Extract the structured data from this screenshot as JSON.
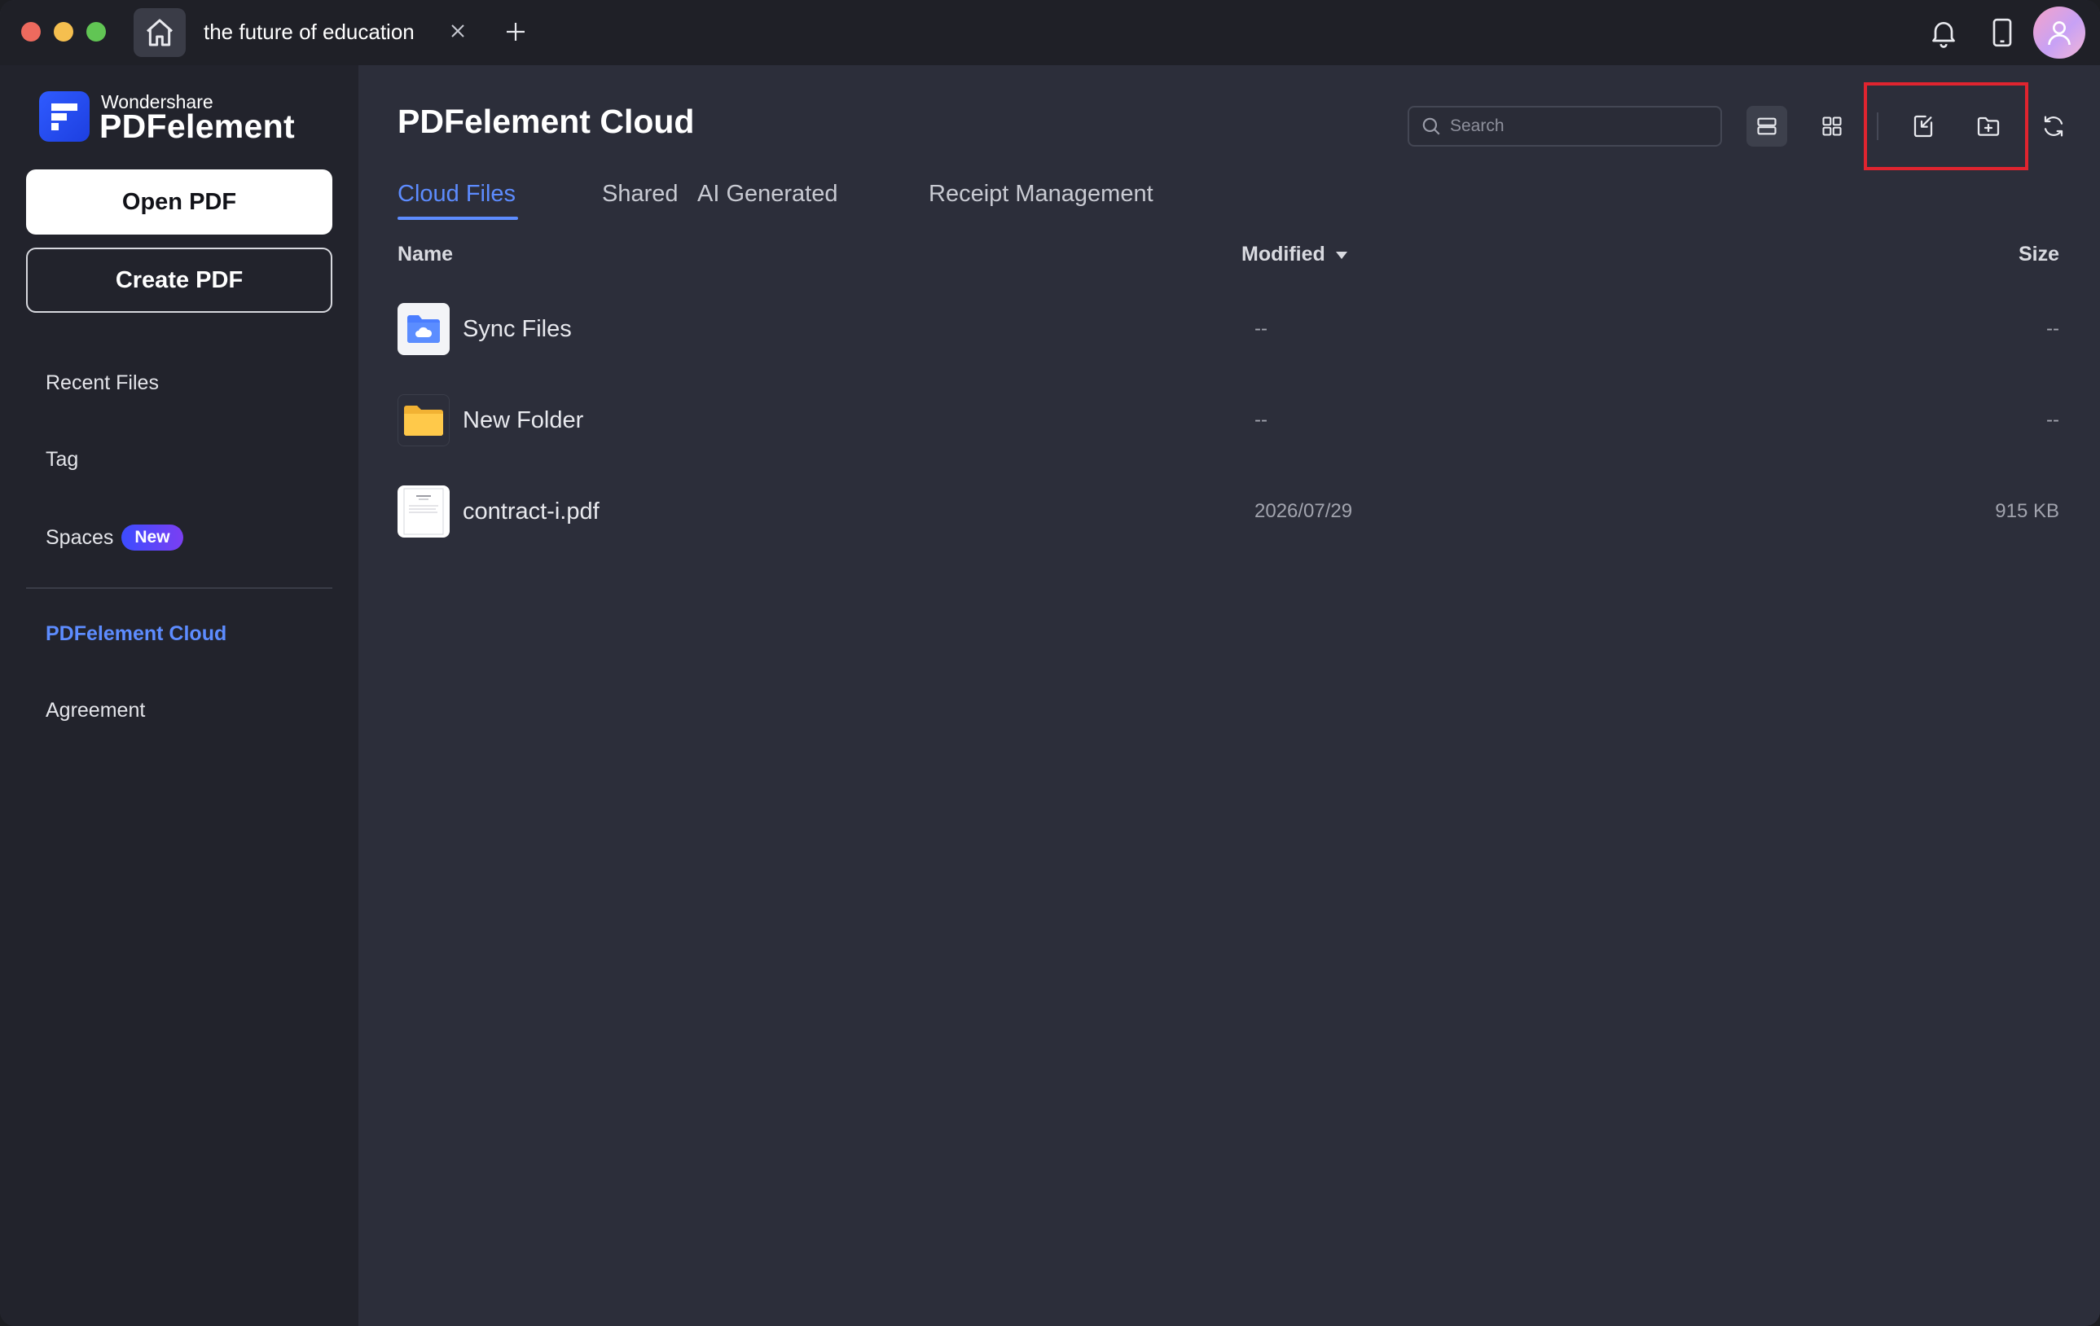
{
  "titlebar": {
    "tab_title": "the future of education"
  },
  "sidebar": {
    "brand_small": "Wondershare",
    "brand_big": "PDFelement",
    "open_pdf_label": "Open PDF",
    "create_pdf_label": "Create PDF",
    "items": {
      "recent": "Recent Files",
      "tag": "Tag",
      "spaces": "Spaces",
      "spaces_badge": "New",
      "cloud": "PDFelement Cloud",
      "agreement": "Agreement"
    },
    "active_item": "PDFelement Cloud"
  },
  "main": {
    "title": "PDFelement Cloud",
    "search_placeholder": "Search",
    "tabs": {
      "cloud_files": "Cloud Files",
      "shared": "Shared",
      "ai_generated": "AI Generated",
      "receipt_management": "Receipt Management"
    },
    "active_tab": "Cloud Files",
    "columns": {
      "name": "Name",
      "modified": "Modified",
      "size": "Size"
    },
    "rows": [
      {
        "name": "Sync Files",
        "modified": "--",
        "size": "--",
        "icon": "cloud-folder-icon"
      },
      {
        "name": "New Folder",
        "modified": "--",
        "size": "--",
        "icon": "folder-icon"
      },
      {
        "name": "contract-i.pdf",
        "modified": "2026/07/29",
        "size": "915 KB",
        "icon": "pdf-thumbnail-icon"
      }
    ]
  },
  "colors": {
    "accent": "#5d8cff",
    "highlight": "#e0242f",
    "sidebar_bg": "#22232c",
    "main_bg": "#2c2e3a"
  }
}
